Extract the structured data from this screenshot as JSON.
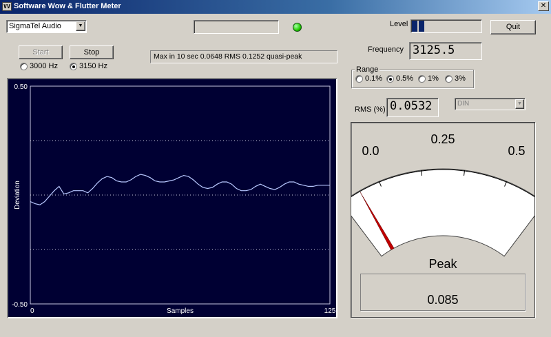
{
  "window": {
    "title": "Software Wow & Flutter Meter",
    "close_glyph": "✕",
    "icon_text": "VV"
  },
  "device": {
    "selected": "SigmaTel Audio",
    "arrow_glyph": "▼"
  },
  "indicator": {
    "led_color": "#22cc00"
  },
  "level": {
    "label": "Level",
    "fill_fraction": 0.2
  },
  "buttons": {
    "quit": "Quit",
    "start": "Start",
    "stop": "Stop"
  },
  "freq_select": {
    "options": [
      {
        "label": "3000 Hz",
        "selected": false
      },
      {
        "label": "3150 Hz",
        "selected": true
      }
    ]
  },
  "status_text": "Max in 10 sec 0.0648 RMS 0.1252 quasi-peak",
  "frequency": {
    "label": "Frequency",
    "value": "3125.5"
  },
  "range": {
    "label": "Range",
    "options": [
      {
        "label": "0.1%",
        "selected": false
      },
      {
        "label": "0.5%",
        "selected": true
      },
      {
        "label": "1%",
        "selected": false
      },
      {
        "label": "3%",
        "selected": false
      }
    ]
  },
  "rms": {
    "label": "RMS (%)",
    "value": "0.0532"
  },
  "weighting": {
    "selected": "DIN",
    "arrow_glyph": "▼"
  },
  "meter": {
    "scale_labels": [
      "0.0",
      "0.25",
      "0.5"
    ],
    "scale_min": 0.0,
    "scale_max": 0.5,
    "needle_value": 0.05,
    "needle_color": "#c00000",
    "peak_label": "Peak",
    "peak_value": "0.085"
  },
  "chart_data": {
    "type": "line",
    "title": "",
    "xlabel": "Samples",
    "ylabel": "Deviation",
    "xlim": [
      0,
      125
    ],
    "ylim": [
      -0.5,
      0.5
    ],
    "x_tick_labels": [
      "0",
      "125"
    ],
    "y_tick_labels": [
      "0.50",
      "-0.50"
    ],
    "grid": "dotted at 0.25, 0, -0.25",
    "background": "#000033",
    "line_color": "#b8c8ff",
    "x": [
      0,
      2,
      4,
      6,
      8,
      10,
      12,
      14,
      16,
      18,
      20,
      22,
      24,
      26,
      28,
      30,
      32,
      34,
      36,
      38,
      40,
      42,
      44,
      46,
      48,
      50,
      52,
      54,
      56,
      58,
      60,
      62,
      64,
      66,
      68,
      70,
      72,
      74,
      76,
      78,
      80,
      82,
      84,
      86,
      88,
      90,
      92,
      94,
      96,
      98,
      100,
      102,
      104,
      106,
      108,
      110,
      112,
      114,
      116,
      118,
      120,
      122,
      124,
      125
    ],
    "y": [
      -0.03,
      -0.04,
      -0.045,
      -0.03,
      -0.005,
      0.02,
      0.04,
      0.005,
      0.01,
      0.02,
      0.02,
      0.02,
      0.01,
      0.03,
      0.055,
      0.075,
      0.085,
      0.08,
      0.065,
      0.06,
      0.06,
      0.07,
      0.085,
      0.095,
      0.09,
      0.08,
      0.065,
      0.06,
      0.06,
      0.065,
      0.07,
      0.08,
      0.09,
      0.085,
      0.07,
      0.05,
      0.035,
      0.03,
      0.035,
      0.05,
      0.06,
      0.06,
      0.05,
      0.03,
      0.02,
      0.02,
      0.025,
      0.04,
      0.05,
      0.04,
      0.03,
      0.025,
      0.035,
      0.05,
      0.06,
      0.06,
      0.05,
      0.045,
      0.04,
      0.04,
      0.045,
      0.045,
      0.045,
      0.045
    ]
  }
}
